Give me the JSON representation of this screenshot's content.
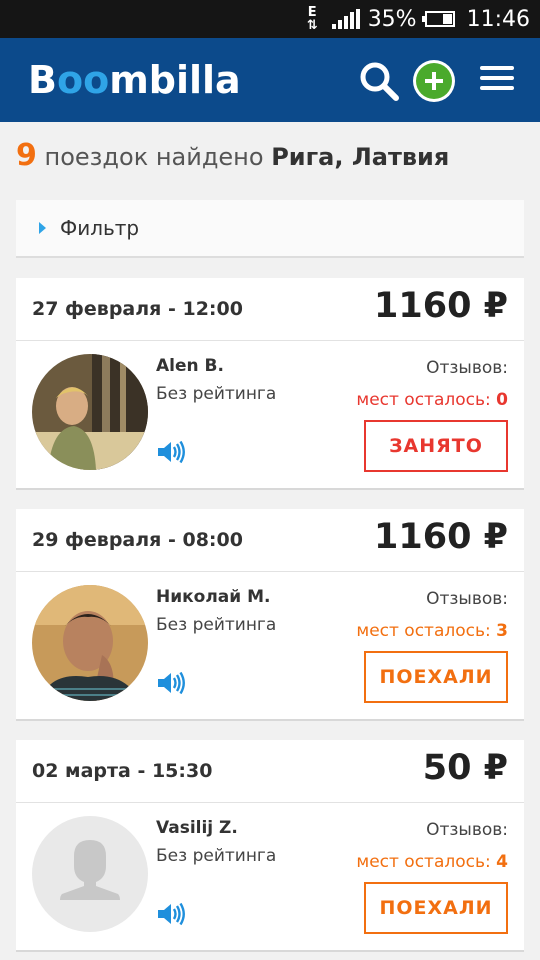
{
  "status_bar": {
    "network_type": "E",
    "battery_percent": "35%",
    "battery_level": 0.35,
    "time": "11:46"
  },
  "app_bar": {
    "logo": {
      "left": "B",
      "middle": "oo",
      "right": "mbilla"
    },
    "icons": [
      "search-icon",
      "add-icon",
      "menu-icon"
    ]
  },
  "results": {
    "count": "9",
    "text": "поездок найдено",
    "city": "Рига, Латвия"
  },
  "filter": {
    "label": "Фильтр"
  },
  "trips": [
    {
      "date": "27 февраля - 12:00",
      "price": "1160 ₽",
      "driver": "Alen B.",
      "rating": "Без рейтинга",
      "reviews_label": "Отзывов:",
      "seats_label": "мест осталось: ",
      "seats_left": "0",
      "action": "ЗАНЯТО"
    },
    {
      "date": "29 февраля - 08:00",
      "price": "1160 ₽",
      "driver": "Николай М.",
      "rating": "Без рейтинга",
      "reviews_label": "Отзывов:",
      "seats_label": "мест осталось: ",
      "seats_left": "3",
      "action": "ПОЕХАЛИ"
    },
    {
      "date": "02 марта - 15:30",
      "price": "50 ₽",
      "driver": "Vasilij Z.",
      "rating": "Без рейтинга",
      "reviews_label": "Отзывов:",
      "seats_label": "мест осталось: ",
      "seats_left": "4",
      "action": "ПОЕХАЛИ"
    }
  ],
  "colors": {
    "brand_blue": "#0c4a8b",
    "accent_light_blue": "#2fa4e7",
    "orange": "#f26f10",
    "red": "#e8372f",
    "green": "#4aaa2c"
  }
}
